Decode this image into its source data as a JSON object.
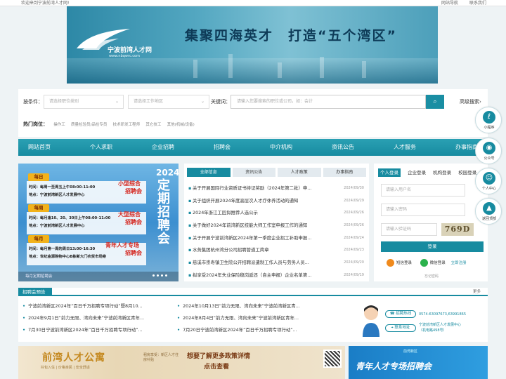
{
  "topbar": {
    "welcome": "欢迎来到宁波前湾人才网!",
    "nav_guide": "网站导航",
    "contact": "联系我们"
  },
  "banner": {
    "logo_title": "宁波前湾人才网",
    "logo_url": "www.nbqwrc.com",
    "slogan": "集聚四海英才　打造“五个湾区”"
  },
  "search": {
    "cond_label": "按条件：",
    "job_category_placeholder": "请选择职位类别",
    "location_placeholder": "请选择工作地区",
    "keyword_label": "关键词：",
    "keyword_placeholder": "请输入您要搜索的职位或公司，如：会计",
    "advanced": "高级搜索",
    "hot_label": "热门岗位：",
    "hot_jobs": [
      "操作工",
      "质量检验员/品检专员",
      "技术研发工程师",
      "其它技工",
      "其他(机械/设备)"
    ]
  },
  "nav": [
    "网站首页",
    "个人求职",
    "企业招聘",
    "招聘会",
    "中介机构",
    "资讯公告",
    "人才服务",
    "办事指南"
  ],
  "promo": {
    "year": "2024",
    "title": "定期招聘会",
    "blocks": [
      {
        "tag": "每日",
        "time": "时间：每周一至周五上午08:00-11:00",
        "place": "地点：宁波前湾新区人才发展中心",
        "type1": "小型综合",
        "type2": "招聘会"
      },
      {
        "tag": "每周",
        "time": "时间：每月逢10、20、30日上午08:00-11:00",
        "place": "地点：宁波前湾新区人才发展中心",
        "type1": "大型综合",
        "type2": "招聘会"
      },
      {
        "tag": "每月",
        "time": "时间：每月第一周的周日13:00-16:30",
        "place": "地点：世纪金源购物中心B栋新大门农贸市场旁",
        "type1": "青年人才专场",
        "type2": "招聘会"
      }
    ],
    "caption": "每月定期招聘会"
  },
  "news": {
    "tabs": [
      "全部信息",
      "资讯公告",
      "人才政策",
      "办事指南"
    ],
    "items": [
      {
        "title": "关于开展国际行业资质证书持证奖励（2024年第二批）申...",
        "date": "2024/09/30"
      },
      {
        "title": "关于组织开展2024年度高层次人才疗休养活动的通知",
        "date": "2024/09/29"
      },
      {
        "title": "2024年浙江工匠拟推荐人选公示",
        "date": "2024/09/26"
      },
      {
        "title": "关于做好2024年前湾新区技能大师工作室申报工作的通知",
        "date": "2024/09/26"
      },
      {
        "title": "关于开展宁波前湾新区2024年第一季度企业招工补助申报...",
        "date": "2024/09/24"
      },
      {
        "title": "水务集团杭州湾分公司招聘管道工简章",
        "date": "2024/09/23"
      },
      {
        "title": "慈溪市崇寿镇卫生院公开招聘派遣制工作人员与劳务人员...",
        "date": "2024/09/20"
      },
      {
        "title": "拟享受2024年失业保险稳岗返还（自主申报）企业名单第...",
        "date": "2024/09/19"
      }
    ]
  },
  "login": {
    "tabs": [
      "个人登录",
      "企业登录",
      "机构登录",
      "校园登录"
    ],
    "user_placeholder": "请输入用户名",
    "pass_placeholder": "请输入密码",
    "captcha_placeholder": "请输入验证码",
    "captcha_text": "769D",
    "button": "登录",
    "sms_login": "短信登录",
    "wechat_login": "微信登录",
    "register": "立即注册",
    "forgot": "忘记密码"
  },
  "fair": {
    "title": "招聘会预告",
    "more": "更多",
    "left": [
      "宁波前湾新区2024年“百日千万招聘专项行动”暨8月10...",
      "2024年9月1日“前力无限、湾向未来”宁波前湾新区青年...",
      "7月30日宁波前湾新区2024年“百日千万招聘专项行动”..."
    ],
    "right": [
      "2024年10月13日“前力无限、湾向未来”宁波前湾新区青...",
      "2024年8月4日“前力无限、湾向未来”宁波前湾新区青年...",
      "7月20日宁波前湾新区2024年“百日千万招聘专项行动”..."
    ],
    "hotline_label": "招聘热线",
    "hotline_value": "0574-63097673,63991865",
    "address_label": "联系地址",
    "address_value": "宁波前湾新区人才发展中心",
    "address_value2": "（机电路498号）"
  },
  "ads": {
    "apt_title": "前湾人才公寓",
    "apt_sub": "拎包入住 | 价格亲民 | 安全舒适",
    "apt_mid": "租房享受：新区人才住房补贴",
    "policy1": "想要了解更多政策详情",
    "policy2": "点击查看",
    "youth_org": "前湾新区",
    "youth_title": "青年人才专场招聘会"
  },
  "float": [
    "小程序",
    "公众号",
    "个人中心",
    "返回顶部"
  ]
}
